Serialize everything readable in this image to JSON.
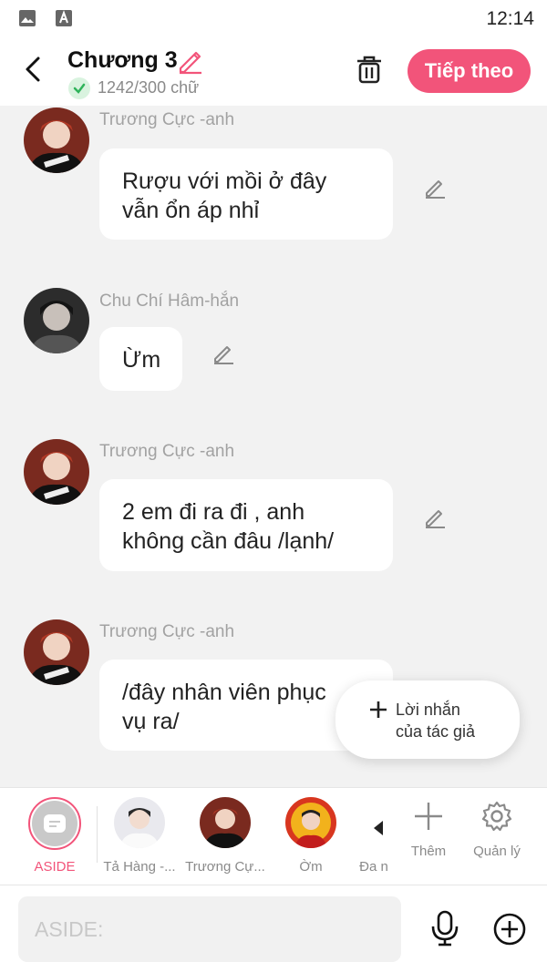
{
  "status_bar": {
    "time": "12:14",
    "icons": [
      "image-icon",
      "keyboard-a-icon"
    ]
  },
  "header": {
    "title": "Chương 3",
    "word_count": "1242/300 chữ",
    "next_label": "Tiếp theo",
    "accent_color": "#f2547a"
  },
  "messages": [
    {
      "sender": "Trương Cực -anh",
      "text": "Rượu với mồi ở đây\nvẫn ổn áp nhỉ",
      "avatar": "truong-cuc-avatar"
    },
    {
      "sender": "Chu Chí Hâm-hắn",
      "text": "Ừm",
      "avatar": "chu-chi-ham-avatar"
    },
    {
      "sender": "Trương Cực -anh",
      "text": "2 em đi ra đi , anh\nkhông cần đâu /lạnh/",
      "avatar": "truong-cuc-avatar"
    },
    {
      "sender": "Trương Cực -anh",
      "text": "/đây nhân viên phục\nvụ ra/",
      "avatar": "truong-cuc-avatar"
    }
  ],
  "author_note": {
    "label": "Lời nhắn\ncủa tác giả"
  },
  "characters": [
    {
      "name": "ASIDE"
    },
    {
      "name": "Tả Hàng -..."
    },
    {
      "name": "Trương Cự..."
    },
    {
      "name": "Ờm"
    },
    {
      "name": "Đa n"
    }
  ],
  "tools": {
    "add_label": "Thêm",
    "manage_label": "Quản lý"
  },
  "input": {
    "placeholder": "ASIDE:",
    "value": ""
  }
}
